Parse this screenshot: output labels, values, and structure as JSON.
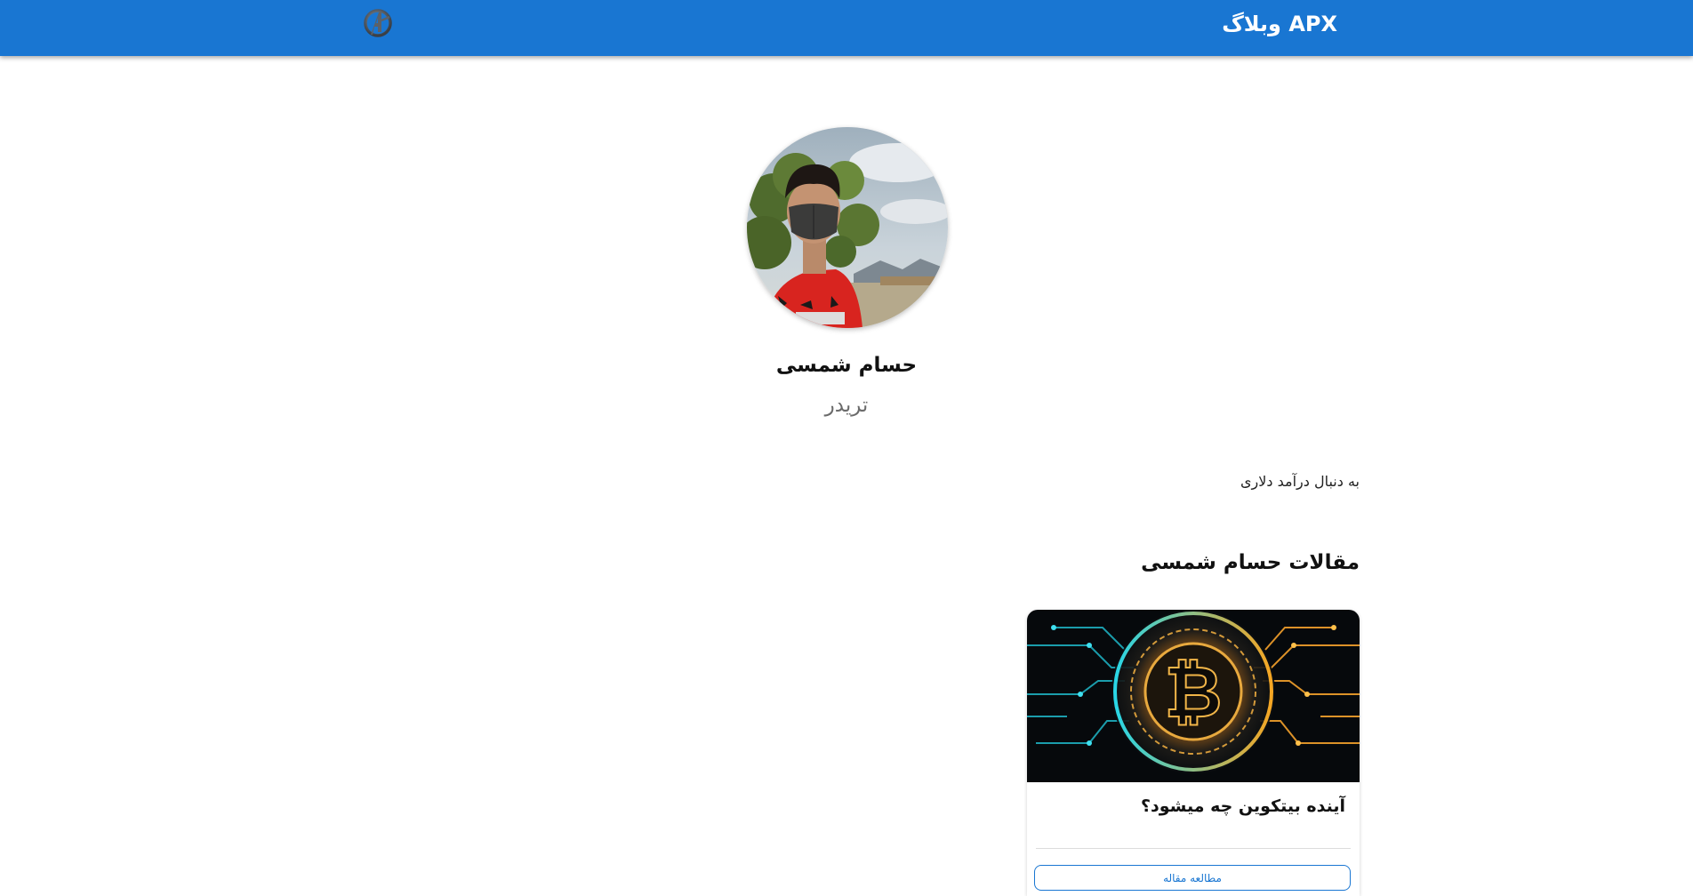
{
  "header": {
    "brand_title": "APX وبلاگ",
    "logo_icon": "avengers-logo-icon",
    "background_color": "#1976d2"
  },
  "profile": {
    "name": "حسام شمسی",
    "role": "تریدر",
    "bio": "به دنبال درآمد دلاری",
    "avatar": "profile-photo"
  },
  "articles": {
    "section_title": "مقالات حسام شمسی",
    "items": [
      {
        "title": "آینده بیتکوین چه میشود؟",
        "image": "bitcoin-illustration",
        "button_label": "مطالعه مقاله"
      }
    ]
  }
}
